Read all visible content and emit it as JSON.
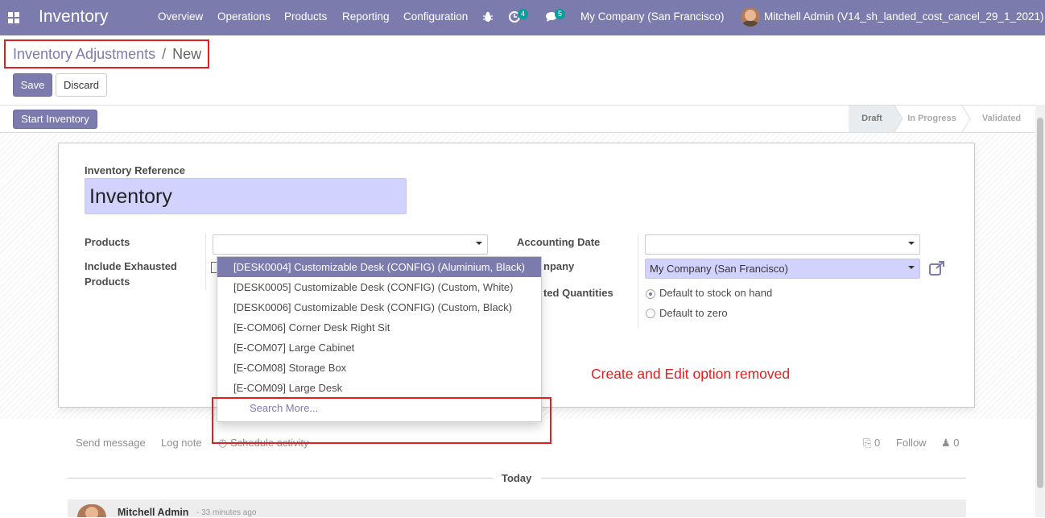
{
  "navbar": {
    "app_name": "Inventory",
    "menus": [
      "Overview",
      "Operations",
      "Products",
      "Reporting",
      "Configuration"
    ],
    "activity_count": "4",
    "message_count": "5",
    "company": "My Company (San Francisco)",
    "user": "Mitchell Admin (V14_sh_landed_cost_cancel_29_1_2021)"
  },
  "breadcrumb": {
    "parent": "Inventory Adjustments",
    "separator": "/",
    "current": "New"
  },
  "buttons": {
    "save": "Save",
    "discard": "Discard",
    "start_inventory": "Start Inventory"
  },
  "statusbar": {
    "steps": [
      "Draft",
      "In Progress",
      "Validated"
    ],
    "active": "Draft"
  },
  "form": {
    "reference_label": "Inventory Reference",
    "reference_value": "Inventory",
    "products_label": "Products",
    "include_exhausted_label_1": "Include Exhausted",
    "include_exhausted_label_2": "Products",
    "accounting_date_label": "Accounting Date",
    "company_label_partial": "npany",
    "company_value": "My Company (San Francisco)",
    "counted_label_partial": "ted Quantities",
    "counted_options": [
      "Default to stock on hand",
      "Default to zero"
    ],
    "counted_selected": "Default to stock on hand"
  },
  "dropdown": {
    "items": [
      "[DESK0004] Customizable Desk (CONFIG) (Aluminium, Black)",
      "[DESK0005] Customizable Desk (CONFIG) (Custom, White)",
      "[DESK0006] Customizable Desk (CONFIG) (Custom, Black)",
      "[E-COM06] Corner Desk Right Sit",
      "[E-COM07] Large Cabinet",
      "[E-COM08] Storage Box",
      "[E-COM09] Large Desk"
    ],
    "search_more": "Search More..."
  },
  "annotation": "Create and Edit option removed",
  "chatter": {
    "send_message": "Send message",
    "log_note": "Log note",
    "schedule_activity": "Schedule activity",
    "attachments": "0",
    "follow": "Follow",
    "followers": "0",
    "today": "Today",
    "author": "Mitchell Admin",
    "time": "- 33 minutes ago"
  },
  "colors": {
    "brand": "#7c7bad",
    "annotation": "#e02020",
    "badge": "#00a09d"
  }
}
